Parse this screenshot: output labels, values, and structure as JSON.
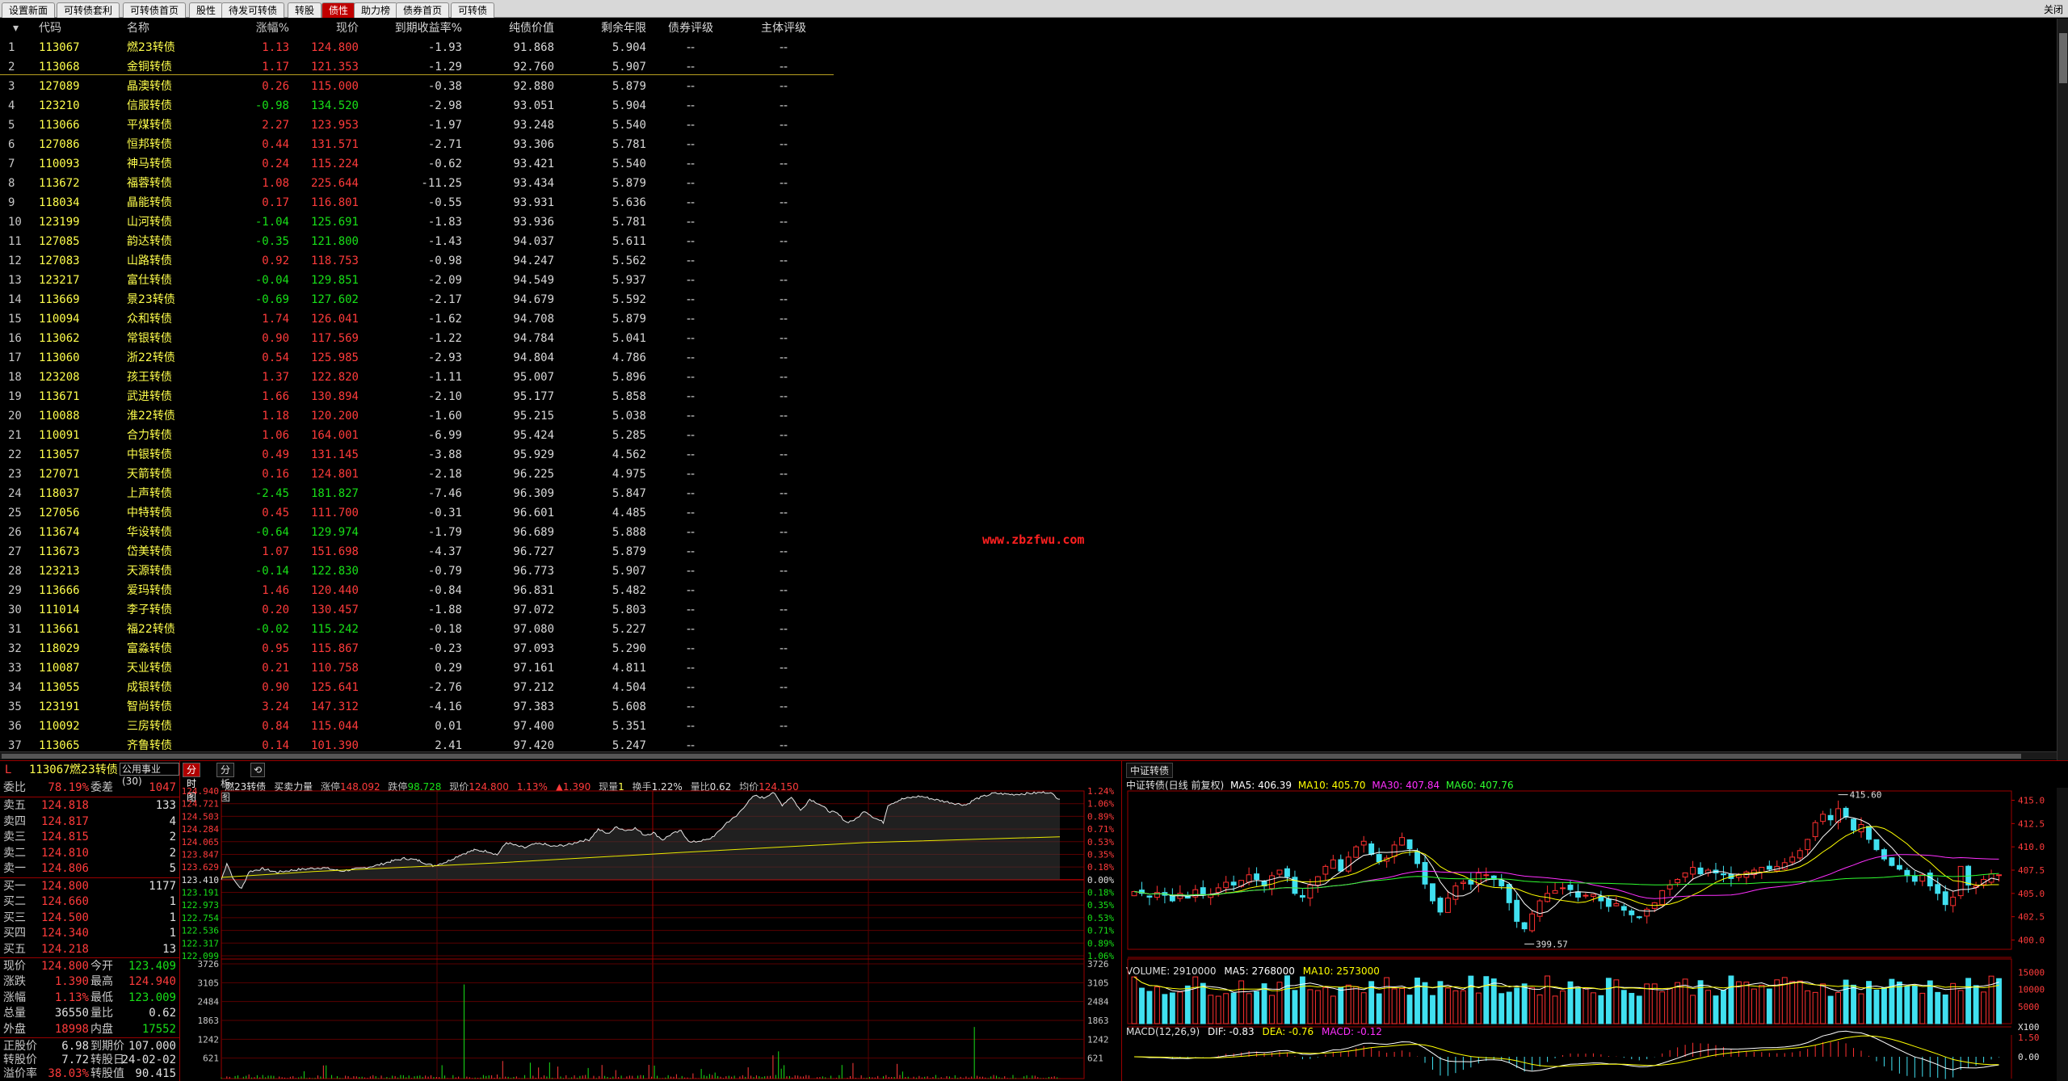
{
  "tabs": [
    {
      "label": "设置新面",
      "active": false
    },
    {
      "label": "可转债套利",
      "active": false
    },
    {
      "label": "可转债首页",
      "active": false
    },
    {
      "label": "股性",
      "active": false
    },
    {
      "label": "待发可转债",
      "active": false
    },
    {
      "label": "转股",
      "active": false
    },
    {
      "label": "债性",
      "active": true
    },
    {
      "label": "助力榜",
      "active": false
    },
    {
      "label": "债券首页",
      "active": false
    },
    {
      "label": "可转债",
      "active": false
    }
  ],
  "close_label": "关闭",
  "table": {
    "sort_icon": "triangle-down-icon",
    "headers": {
      "code": "代码",
      "name": "名称",
      "chg": "涨幅%",
      "price": "现价",
      "ytm": "到期收益率%",
      "pure": "纯债价值",
      "years": "剩余年限",
      "rating": "债券评级",
      "entity_rating": "主体评级"
    },
    "rows": [
      {
        "idx": "1",
        "code": "113067",
        "name": "燃23转债",
        "chg": "1.13",
        "price": "124.800",
        "ytm": "-1.93",
        "pure": "91.868",
        "years": "5.904",
        "rating": "--",
        "erating": "--"
      },
      {
        "idx": "2",
        "code": "113068",
        "name": "金铜转债",
        "chg": "1.17",
        "price": "121.353",
        "ytm": "-1.29",
        "pure": "92.760",
        "years": "5.907",
        "rating": "--",
        "erating": "--"
      },
      {
        "idx": "3",
        "code": "127089",
        "name": "晶澳转债",
        "chg": "0.26",
        "price": "115.000",
        "ytm": "-0.38",
        "pure": "92.880",
        "years": "5.879",
        "rating": "--",
        "erating": "--"
      },
      {
        "idx": "4",
        "code": "123210",
        "name": "信服转债",
        "chg": "-0.98",
        "price": "134.520",
        "ytm": "-2.98",
        "pure": "93.051",
        "years": "5.904",
        "rating": "--",
        "erating": "--"
      },
      {
        "idx": "5",
        "code": "113066",
        "name": "平煤转债",
        "chg": "2.27",
        "price": "123.953",
        "ytm": "-1.97",
        "pure": "93.248",
        "years": "5.540",
        "rating": "--",
        "erating": "--"
      },
      {
        "idx": "6",
        "code": "127086",
        "name": "恒邦转债",
        "chg": "0.44",
        "price": "131.571",
        "ytm": "-2.71",
        "pure": "93.306",
        "years": "5.781",
        "rating": "--",
        "erating": "--"
      },
      {
        "idx": "7",
        "code": "110093",
        "name": "神马转债",
        "chg": "0.24",
        "price": "115.224",
        "ytm": "-0.62",
        "pure": "93.421",
        "years": "5.540",
        "rating": "--",
        "erating": "--"
      },
      {
        "idx": "8",
        "code": "113672",
        "name": "福蓉转债",
        "chg": "1.08",
        "price": "225.644",
        "ytm": "-11.25",
        "pure": "93.434",
        "years": "5.879",
        "rating": "--",
        "erating": "--"
      },
      {
        "idx": "9",
        "code": "118034",
        "name": "晶能转债",
        "chg": "0.17",
        "price": "116.801",
        "ytm": "-0.55",
        "pure": "93.931",
        "years": "5.636",
        "rating": "--",
        "erating": "--"
      },
      {
        "idx": "10",
        "code": "123199",
        "name": "山河转债",
        "chg": "-1.04",
        "price": "125.691",
        "ytm": "-1.83",
        "pure": "93.936",
        "years": "5.781",
        "rating": "--",
        "erating": "--"
      },
      {
        "idx": "11",
        "code": "127085",
        "name": "韵达转债",
        "chg": "-0.35",
        "price": "121.800",
        "ytm": "-1.43",
        "pure": "94.037",
        "years": "5.611",
        "rating": "--",
        "erating": "--"
      },
      {
        "idx": "12",
        "code": "127083",
        "name": "山路转债",
        "chg": "0.92",
        "price": "118.753",
        "ytm": "-0.98",
        "pure": "94.247",
        "years": "5.562",
        "rating": "--",
        "erating": "--"
      },
      {
        "idx": "13",
        "code": "123217",
        "name": "富仕转债",
        "chg": "-0.04",
        "price": "129.851",
        "ytm": "-2.09",
        "pure": "94.549",
        "years": "5.937",
        "rating": "--",
        "erating": "--"
      },
      {
        "idx": "14",
        "code": "113669",
        "name": "景23转债",
        "chg": "-0.69",
        "price": "127.602",
        "ytm": "-2.17",
        "pure": "94.679",
        "years": "5.592",
        "rating": "--",
        "erating": "--"
      },
      {
        "idx": "15",
        "code": "110094",
        "name": "众和转债",
        "chg": "1.74",
        "price": "126.041",
        "ytm": "-1.62",
        "pure": "94.708",
        "years": "5.879",
        "rating": "--",
        "erating": "--"
      },
      {
        "idx": "16",
        "code": "113062",
        "name": "常银转债",
        "chg": "0.90",
        "price": "117.569",
        "ytm": "-1.22",
        "pure": "94.784",
        "years": "5.041",
        "rating": "--",
        "erating": "--"
      },
      {
        "idx": "17",
        "code": "113060",
        "name": "浙22转债",
        "chg": "0.54",
        "price": "125.985",
        "ytm": "-2.93",
        "pure": "94.804",
        "years": "4.786",
        "rating": "--",
        "erating": "--"
      },
      {
        "idx": "18",
        "code": "123208",
        "name": "孩王转债",
        "chg": "1.37",
        "price": "122.820",
        "ytm": "-1.11",
        "pure": "95.007",
        "years": "5.896",
        "rating": "--",
        "erating": "--"
      },
      {
        "idx": "19",
        "code": "113671",
        "name": "武进转债",
        "chg": "1.66",
        "price": "130.894",
        "ytm": "-2.10",
        "pure": "95.177",
        "years": "5.858",
        "rating": "--",
        "erating": "--"
      },
      {
        "idx": "20",
        "code": "110088",
        "name": "淮22转债",
        "chg": "1.18",
        "price": "120.200",
        "ytm": "-1.60",
        "pure": "95.215",
        "years": "5.038",
        "rating": "--",
        "erating": "--"
      },
      {
        "idx": "21",
        "code": "110091",
        "name": "合力转债",
        "chg": "1.06",
        "price": "164.001",
        "ytm": "-6.99",
        "pure": "95.424",
        "years": "5.285",
        "rating": "--",
        "erating": "--"
      },
      {
        "idx": "22",
        "code": "113057",
        "name": "中银转债",
        "chg": "0.49",
        "price": "131.145",
        "ytm": "-3.88",
        "pure": "95.929",
        "years": "4.562",
        "rating": "--",
        "erating": "--"
      },
      {
        "idx": "23",
        "code": "127071",
        "name": "天箭转债",
        "chg": "0.16",
        "price": "124.801",
        "ytm": "-2.18",
        "pure": "96.225",
        "years": "4.975",
        "rating": "--",
        "erating": "--"
      },
      {
        "idx": "24",
        "code": "118037",
        "name": "上声转债",
        "chg": "-2.45",
        "price": "181.827",
        "ytm": "-7.46",
        "pure": "96.309",
        "years": "5.847",
        "rating": "--",
        "erating": "--"
      },
      {
        "idx": "25",
        "code": "127056",
        "name": "中特转债",
        "chg": "0.45",
        "price": "111.700",
        "ytm": "-0.31",
        "pure": "96.601",
        "years": "4.485",
        "rating": "--",
        "erating": "--"
      },
      {
        "idx": "26",
        "code": "113674",
        "name": "华设转债",
        "chg": "-0.64",
        "price": "129.974",
        "ytm": "-1.79",
        "pure": "96.689",
        "years": "5.888",
        "rating": "--",
        "erating": "--"
      },
      {
        "idx": "27",
        "code": "113673",
        "name": "岱美转债",
        "chg": "1.07",
        "price": "151.698",
        "ytm": "-4.37",
        "pure": "96.727",
        "years": "5.879",
        "rating": "--",
        "erating": "--"
      },
      {
        "idx": "28",
        "code": "123213",
        "name": "天源转债",
        "chg": "-0.14",
        "price": "122.830",
        "ytm": "-0.79",
        "pure": "96.773",
        "years": "5.907",
        "rating": "--",
        "erating": "--"
      },
      {
        "idx": "29",
        "code": "113666",
        "name": "爱玛转债",
        "chg": "1.46",
        "price": "120.440",
        "ytm": "-0.84",
        "pure": "96.831",
        "years": "5.482",
        "rating": "--",
        "erating": "--"
      },
      {
        "idx": "30",
        "code": "111014",
        "name": "李子转债",
        "chg": "0.20",
        "price": "130.457",
        "ytm": "-1.88",
        "pure": "97.072",
        "years": "5.803",
        "rating": "--",
        "erating": "--"
      },
      {
        "idx": "31",
        "code": "113661",
        "name": "福22转债",
        "chg": "-0.02",
        "price": "115.242",
        "ytm": "-0.18",
        "pure": "97.080",
        "years": "5.227",
        "rating": "--",
        "erating": "--"
      },
      {
        "idx": "32",
        "code": "118029",
        "name": "富淼转债",
        "chg": "0.95",
        "price": "115.867",
        "ytm": "-0.23",
        "pure": "97.093",
        "years": "5.290",
        "rating": "--",
        "erating": "--"
      },
      {
        "idx": "33",
        "code": "110087",
        "name": "天业转债",
        "chg": "0.21",
        "price": "110.758",
        "ytm": "0.29",
        "pure": "97.161",
        "years": "4.811",
        "rating": "--",
        "erating": "--"
      },
      {
        "idx": "34",
        "code": "113055",
        "name": "成银转债",
        "chg": "0.90",
        "price": "125.641",
        "ytm": "-2.76",
        "pure": "97.212",
        "years": "4.504",
        "rating": "--",
        "erating": "--"
      },
      {
        "idx": "35",
        "code": "123191",
        "name": "智尚转债",
        "chg": "3.24",
        "price": "147.312",
        "ytm": "-4.16",
        "pure": "97.383",
        "years": "5.608",
        "rating": "--",
        "erating": "--"
      },
      {
        "idx": "36",
        "code": "110092",
        "name": "三房转债",
        "chg": "0.84",
        "price": "115.044",
        "ytm": "0.01",
        "pure": "97.400",
        "years": "5.351",
        "rating": "--",
        "erating": "--"
      },
      {
        "idx": "37",
        "code": "113065",
        "name": "齐鲁转债",
        "chg": "0.14",
        "price": "101.390",
        "ytm": "2.41",
        "pure": "97.420",
        "years": "5.247",
        "rating": "--",
        "erating": "--"
      }
    ]
  },
  "watermark": "www.zbzfwu.com",
  "quote": {
    "marker": "L",
    "code": "113067",
    "name": "燃23转债",
    "industry": "公用事业(30)",
    "webi_label": "委比",
    "webi": "78.19%",
    "weicha_label": "委差",
    "weicha": "1047",
    "asks": [
      {
        "label": "卖五",
        "price": "124.818",
        "vol": "133"
      },
      {
        "label": "卖四",
        "price": "124.817",
        "vol": "4"
      },
      {
        "label": "卖三",
        "price": "124.815",
        "vol": "2"
      },
      {
        "label": "卖二",
        "price": "124.810",
        "vol": "2"
      },
      {
        "label": "卖一",
        "price": "124.806",
        "vol": "5"
      }
    ],
    "bids": [
      {
        "label": "买一",
        "price": "124.800",
        "vol": "1177"
      },
      {
        "label": "买二",
        "price": "124.660",
        "vol": "1"
      },
      {
        "label": "买三",
        "price": "124.500",
        "vol": "1"
      },
      {
        "label": "买四",
        "price": "124.340",
        "vol": "1"
      },
      {
        "label": "买五",
        "price": "124.218",
        "vol": "13"
      }
    ],
    "stats": [
      {
        "l1": "现价",
        "v1": "124.800",
        "l2": "今开",
        "v2": "123.409"
      },
      {
        "l1": "涨跌",
        "v1": "1.390",
        "l2": "最高",
        "v2": "124.940"
      },
      {
        "l1": "涨幅",
        "v1": "1.13%",
        "l2": "最低",
        "v2": "123.009"
      },
      {
        "l1": "总量",
        "v1": "36550",
        "l2": "量比",
        "v2": "0.62"
      },
      {
        "l1": "外盘",
        "v1": "18998",
        "l2": "内盘",
        "v2": "17552"
      }
    ],
    "bond": [
      {
        "l1": "正股价",
        "v1": "6.98",
        "l2": "到期价",
        "v2": "107.000"
      },
      {
        "l1": "转股价",
        "v1": "7.72",
        "l2": "转股日",
        "v2": "24-02-02"
      },
      {
        "l1": "溢价率",
        "v1": "38.03%",
        "l2": "转股值",
        "v2": "90.415"
      }
    ]
  },
  "intraday": {
    "tab_active": "分时图",
    "tab_other": "分析图",
    "info": {
      "name": "燃23转债",
      "force": "买卖力量",
      "zt_label": "涨停",
      "zt": "148.092",
      "dt_label": "跌停",
      "dt": "98.728",
      "price_label": "现价",
      "price": "124.800",
      "pct": "1.13%",
      "delta": "▲1.390",
      "cur_label": "现量",
      "cur": "1",
      "turn_label": "换手",
      "turn": "1.22%",
      "lb_label": "量比",
      "lb": "0.62",
      "avg_label": "均价",
      "avg": "124.150"
    },
    "price_ticks": [
      "124.940",
      "124.721",
      "124.503",
      "124.284",
      "124.065",
      "123.847",
      "123.629",
      "123.410",
      "123.191",
      "122.973",
      "122.754",
      "122.536",
      "122.317",
      "122.099"
    ],
    "pct_ticks": [
      "1.24%",
      "1.06%",
      "0.89%",
      "0.71%",
      "0.53%",
      "0.35%",
      "0.18%",
      "0.00%",
      "0.18%",
      "0.35%",
      "0.53%",
      "0.71%",
      "0.89%",
      "1.06%"
    ],
    "vol_ticks": [
      "3726",
      "3105",
      "2484",
      "1863",
      "1242",
      "621"
    ],
    "colors": {
      "price_line": "#e8e8e8",
      "avg_line": "#e8e800"
    }
  },
  "kline": {
    "title": "中证转债",
    "info": {
      "name": "中证转债(日线 前复权)",
      "ma5": "MA5: 406.39",
      "ma10": "MA10: 405.70",
      "ma30": "MA30: 407.84",
      "ma60": "MA60: 407.76"
    },
    "price_ticks": [
      "415.0",
      "412.5",
      "410.0",
      "407.5",
      "405.0",
      "402.5",
      "400.0"
    ],
    "high_label": "415.60",
    "low_label": "399.57",
    "volume_info": {
      "vol": "VOLUME: 2910000",
      "ma5": "MA5: 2768000",
      "ma10": "MA10: 2573000"
    },
    "vol_ticks": [
      "15000",
      "10000",
      "5000",
      "X100"
    ],
    "macd_info": {
      "name": "MACD(12,26,9)",
      "dif": "DIF: -0.83",
      "dea": "DEA: -0.76",
      "macd": "MACD: -0.12"
    },
    "macd_ticks": [
      "1.50",
      "0.00"
    ],
    "colors": {
      "up": "#ff3030",
      "down": "#40e0f0",
      "ma5": "#ffffff",
      "ma10": "#ffff00",
      "ma30": "#ff30ff",
      "ma60": "#30ff30"
    }
  }
}
